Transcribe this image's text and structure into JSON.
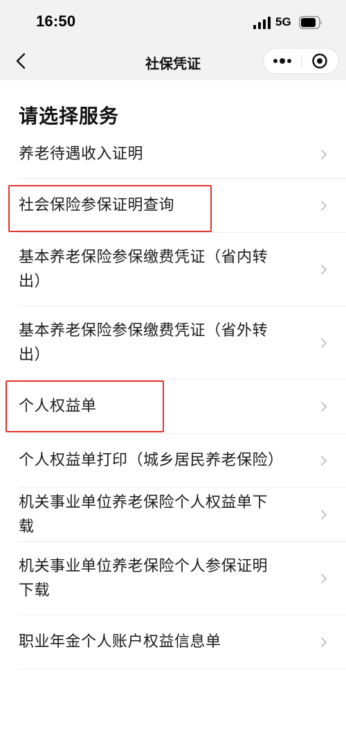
{
  "status_bar": {
    "time": "16:50",
    "network": "5G",
    "icons": [
      "signal-icon",
      "battery-icon"
    ]
  },
  "nav": {
    "title": "社保凭证",
    "icons": [
      "back-arrow-icon",
      "more-dots-icon",
      "close-circle-icon"
    ]
  },
  "page": {
    "heading": "请选择服务"
  },
  "services": [
    {
      "label": "养老待遇收入证明"
    },
    {
      "label": "社会保险参保证明查询",
      "highlighted": true
    },
    {
      "label": "基本养老保险参保缴费凭证（省内转出）"
    },
    {
      "label": "基本养老保险参保缴费凭证（省外转出）"
    },
    {
      "label": "个人权益单",
      "highlighted": true
    },
    {
      "label": "个人权益单打印（城乡居民养老保险）"
    },
    {
      "label": "机关事业单位养老保险个人权益单下载"
    },
    {
      "label": "机关事业单位养老保险个人参保证明下载"
    },
    {
      "label": "职业年金个人账户权益信息单"
    }
  ],
  "colors": {
    "bar_background": "#f2f2f3",
    "highlight": "#e0312f",
    "chevron": "#c4c4c6",
    "divider": "#ececec"
  }
}
